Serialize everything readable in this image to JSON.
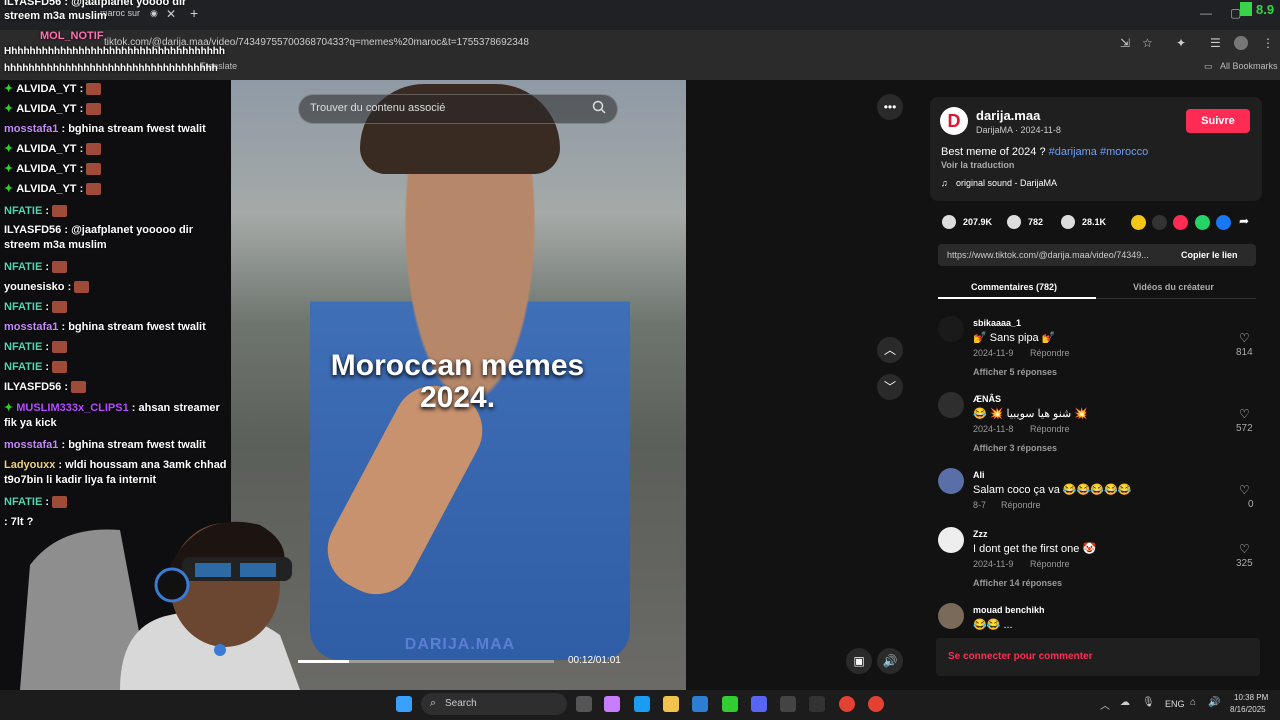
{
  "browser": {
    "tab_title": "maroc sur",
    "url": "tiktok.com/@darija.maa/video/7434975570036870433?q=memes%20maroc&t=1755378692348",
    "bookmarks_translate": "Translate",
    "bookmarks_all": "All Bookmarks",
    "counter": "8.9"
  },
  "overlay_chat": [
    {
      "user": "ILYASFD56",
      "text": ": @jaafplanet yoooo dir"
    },
    {
      "user": "",
      "text": "streem m3a muslim"
    },
    {
      "user": "MOL_NOTIF",
      "text": ":"
    },
    {
      "user": "",
      "text": "Hhhhhhhhhhhhhhhhhhhhhhhhhhhhhhhhhhhh"
    },
    {
      "user": "",
      "text": "hhhhhhhhhhhhhhhhhhhhhhhhhhhhhhhhhhh"
    }
  ],
  "chat": [
    {
      "user": "ALVIDA_YT",
      "color": "#ffffff",
      "text": ":",
      "gem": true,
      "emote": true
    },
    {
      "user": "ALVIDA_YT",
      "color": "#ffffff",
      "text": ":",
      "gem": true,
      "emote": true
    },
    {
      "user": "mosstafa1",
      "color": "#c58af9",
      "text": ": bghina stream fwest twalit",
      "gem": false,
      "emote": false
    },
    {
      "user": "ALVIDA_YT",
      "color": "#ffffff",
      "text": ":",
      "gem": true,
      "emote": true
    },
    {
      "user": "ALVIDA_YT",
      "color": "#ffffff",
      "text": ":",
      "gem": true,
      "emote": true
    },
    {
      "user": "ALVIDA_YT",
      "color": "#ffffff",
      "text": ":",
      "gem": true,
      "emote": true
    },
    {
      "user": "NFATIE",
      "color": "#4fd6b3",
      "text": ":",
      "gem": false,
      "emote": true
    },
    {
      "user": "ILYASFD56",
      "color": "#ffffff",
      "text": ": @jaafplanet yooooo dir streem m3a muslim",
      "gem": false,
      "emote": false
    },
    {
      "user": "NFATIE",
      "color": "#4fd6b3",
      "text": ":",
      "gem": false,
      "emote": true
    },
    {
      "user": "younesisko",
      "color": "#ffffff",
      "text": ":",
      "gem": false,
      "emote": true
    },
    {
      "user": "NFATIE",
      "color": "#4fd6b3",
      "text": ":",
      "gem": false,
      "emote": true
    },
    {
      "user": "mosstafa1",
      "color": "#c58af9",
      "text": ": bghina stream fwest twalit",
      "gem": false,
      "emote": false
    },
    {
      "user": "NFATIE",
      "color": "#4fd6b3",
      "text": ":",
      "gem": false,
      "emote": true
    },
    {
      "user": "NFATIE",
      "color": "#4fd6b3",
      "text": ":",
      "gem": false,
      "emote": true
    },
    {
      "user": "ILYASFD56",
      "color": "#ffffff",
      "text": ":",
      "gem": false,
      "emote": true
    },
    {
      "user": "MUSLIM333x_CLIPS1",
      "color": "#b44cff",
      "text": ": ahsan streamer fik ya kick",
      "gem": true,
      "emote": false
    },
    {
      "user": "mosstafa1",
      "color": "#c58af9",
      "text": ": bghina stream fwest twalit",
      "gem": false,
      "emote": false
    },
    {
      "user": "Ladyouxx",
      "color": "#f2d17a",
      "text": ": wldi houssam ana 3amk chhad t9o7bin li kadir liya fa internit",
      "gem": false,
      "emote": false
    },
    {
      "user": "NFATIE",
      "color": "#4fd6b3",
      "text": ":",
      "gem": false,
      "emote": true
    },
    {
      "user": "",
      "color": "#ffffff",
      "text": ": 7lt ?",
      "gem": false,
      "emote": false
    }
  ],
  "video": {
    "search_placeholder": "Trouver du contenu associé",
    "caption_line1": "Moroccan memes",
    "caption_line2": "2024.",
    "watermark": "DARIJA.MAA",
    "time": "00:12/01:01",
    "progress": 0.2
  },
  "panel": {
    "username": "darija.maa",
    "author_line": "DarijaMA · 2024-11-8",
    "follow": "Suivre",
    "description": "Best meme of 2024 ?",
    "hashtags": "#darijama #morocco",
    "translate": "Voir la traduction",
    "sound": "original sound - DarijaMA",
    "likes": "207.9K",
    "comments_count": "782",
    "saves": "28.1K",
    "link": "https://www.tiktok.com/@darija.maa/video/74349...",
    "copy_link": "Copier le lien",
    "tab_comments": "Commentaires (782)",
    "tab_videos": "Vidéos du créateur",
    "login": "Se connecter pour commenter",
    "colors": {
      "accent": "#fe2c55",
      "hashtag": "#6e9ff6"
    }
  },
  "comments": [
    {
      "user": "sbikaaaa_1",
      "text": "💅 Sans pipa 💅",
      "date": "2024-11-9",
      "reply": "Répondre",
      "likes": "814",
      "more": "Afficher 5 réponses"
    },
    {
      "user": "ÆNÂS",
      "text": "😂 💥 شنو هيا سويبيا 💥",
      "date": "2024-11-8",
      "reply": "Répondre",
      "likes": "572",
      "more": "Afficher 3 réponses"
    },
    {
      "user": "Ali",
      "text": "Salam coco ça va 😂😂😂😂😂",
      "date": "8-7",
      "reply": "Répondre",
      "likes": "0",
      "more": ""
    },
    {
      "user": "Zzz",
      "text": "I dont get the first one 🤡",
      "date": "2024-11-9",
      "reply": "Répondre",
      "likes": "325",
      "more": "Afficher 14 réponses"
    },
    {
      "user": "mouad benchikh",
      "text": "😂😂 ...",
      "date": "",
      "reply": "",
      "likes": "",
      "more": ""
    }
  ],
  "taskbar": {
    "search": "Search",
    "lang": "ENG",
    "time": "10:38 PM",
    "date": "8/16/2025"
  }
}
